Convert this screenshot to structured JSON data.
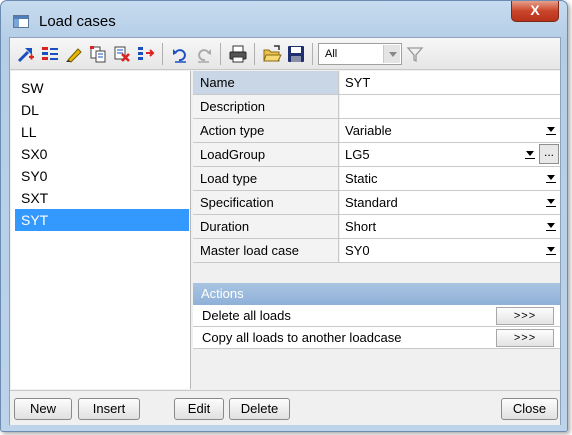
{
  "window": {
    "title": "Load cases",
    "close_glyph": "X"
  },
  "toolbar": {
    "icons": [
      "new-case-icon",
      "properties-icon",
      "edit-pencil-icon",
      "copy-icon",
      "delete-case-icon",
      "reorder-icon",
      "undo-icon",
      "redo-icon",
      "print-icon",
      "open-folder-icon",
      "save-disk-icon",
      "filter-icon"
    ],
    "filter_value": "All"
  },
  "load_cases": [
    "SW",
    "DL",
    "LL",
    "SX0",
    "SY0",
    "SXT",
    "SYT"
  ],
  "selected_case": "SYT",
  "properties": {
    "name": {
      "label": "Name",
      "value": "SYT"
    },
    "description": {
      "label": "Description",
      "value": ""
    },
    "action_type": {
      "label": "Action type",
      "value": "Variable"
    },
    "load_group": {
      "label": "LoadGroup",
      "value": "LG5",
      "button": "..."
    },
    "load_type": {
      "label": "Load type",
      "value": "Static"
    },
    "specification": {
      "label": "Specification",
      "value": "Standard"
    },
    "duration": {
      "label": "Duration",
      "value": "Short"
    },
    "master_load_case": {
      "label": "Master load case",
      "value": "SY0"
    }
  },
  "actions": {
    "header": "Actions",
    "items": [
      {
        "label": "Delete all loads",
        "button": ">>>"
      },
      {
        "label": "Copy all loads to another loadcase",
        "button": ">>>"
      }
    ]
  },
  "buttons": {
    "new": "New",
    "insert": "Insert",
    "edit": "Edit",
    "delete": "Delete",
    "close": "Close"
  },
  "colors": {
    "selection": "#3399ff",
    "actions_header": "#9dbbe0",
    "title_close": "#c9452a"
  }
}
